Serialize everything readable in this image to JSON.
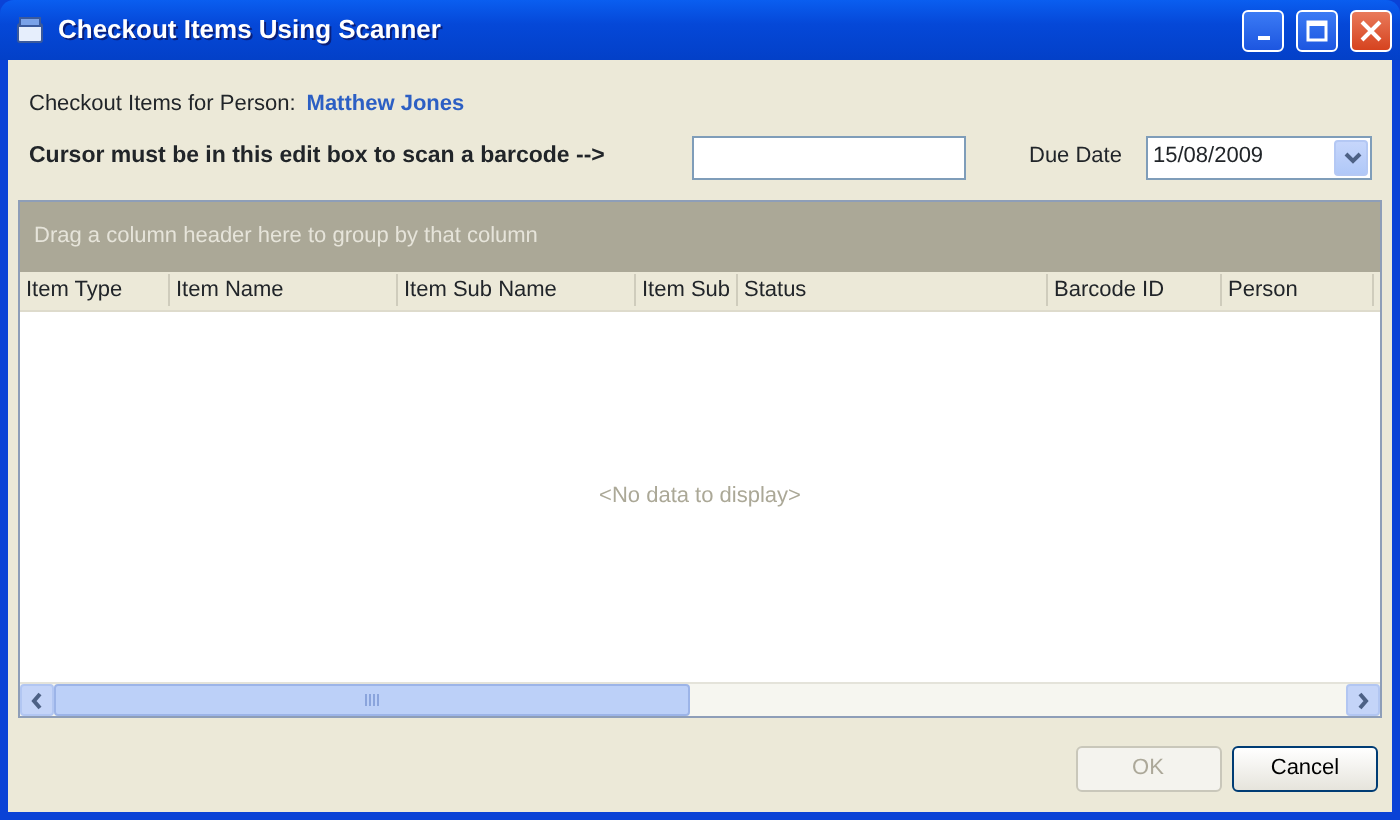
{
  "window": {
    "title": "Checkout Items Using Scanner"
  },
  "person": {
    "label": "Checkout Items for Person:",
    "name": "Matthew Jones"
  },
  "scan": {
    "label": "Cursor must be in this edit box to scan a barcode -->"
  },
  "due_date": {
    "label": "Due Date",
    "value": "15/08/2009"
  },
  "grid": {
    "group_hint": "Drag a column header here to group by that column",
    "columns": [
      {
        "label": "Item Type"
      },
      {
        "label": "Item Name"
      },
      {
        "label": "Item Sub Name"
      },
      {
        "label": "Item Sub"
      },
      {
        "label": "Status"
      },
      {
        "label": "Barcode ID"
      },
      {
        "label": "Person"
      }
    ],
    "empty_text": "<No data to display>"
  },
  "buttons": [
    {
      "label": "OK",
      "disabled": true
    },
    {
      "label": "Cancel",
      "disabled": false
    }
  ]
}
